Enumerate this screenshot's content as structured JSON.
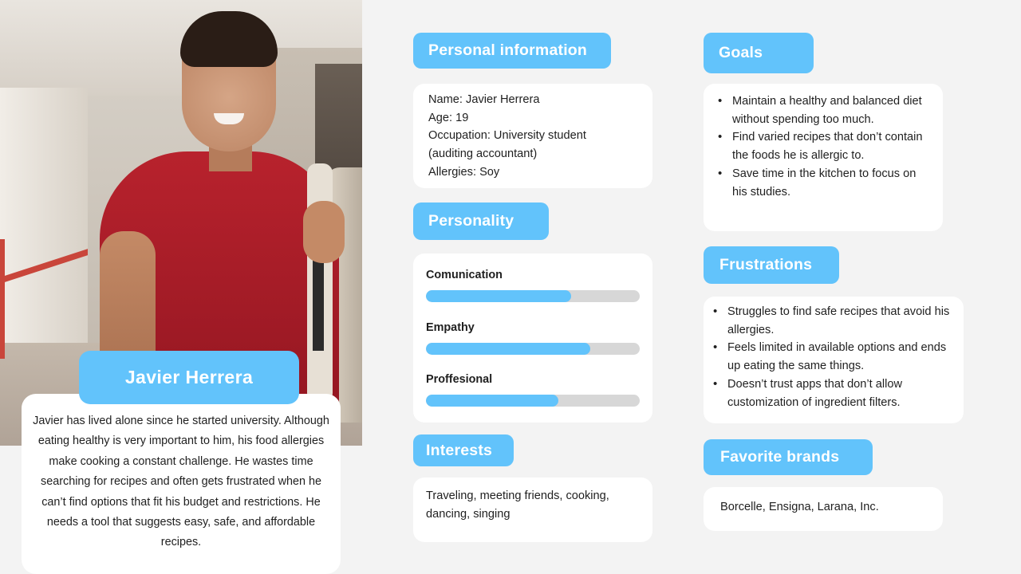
{
  "persona": {
    "name": "Javier Herrera",
    "bio": "Javier has lived alone since he started university. Although eating healthy is very important to him, his food allergies make cooking a constant challenge. He wastes time searching for recipes and often gets frustrated when he can’t find options that fit his budget and restrictions. He needs a tool that suggests easy, safe, and affordable recipes."
  },
  "personal_information": {
    "title": "Personal information",
    "lines": [
      "Name: Javier Herrera",
      "Age: 19",
      "Occupation: University student",
      "(auditing accountant)",
      "Allergies: Soy"
    ]
  },
  "personality": {
    "title": "Personality",
    "traits": [
      {
        "label": "Comunication",
        "level": 0.68
      },
      {
        "label": "Empathy",
        "level": 0.77
      },
      {
        "label": "Proffesional",
        "level": 0.62
      }
    ]
  },
  "interests": {
    "title": "Interests",
    "text": "Traveling, meeting friends, cooking, dancing, singing"
  },
  "goals": {
    "title": "Goals",
    "items": [
      "Maintain a healthy and balanced diet without spending too much.",
      "Find varied recipes that don’t contain the foods he is allergic to.",
      "Save time in the kitchen to focus on his studies."
    ]
  },
  "frustrations": {
    "title": "Frustrations",
    "items": [
      "Struggles to find safe recipes that avoid his allergies.",
      "Feels limited in available options and ends up eating the same things.",
      "Doesn’t trust apps that don’t allow customization of ingredient filters."
    ]
  },
  "favorite_brands": {
    "title": "Favorite brands",
    "text": "Borcelle, Ensigna, Larana, Inc."
  },
  "colors": {
    "accent": "#62c3fb",
    "card": "#ffffff",
    "background": "#f3f3f3",
    "track": "#d7d7d7"
  }
}
